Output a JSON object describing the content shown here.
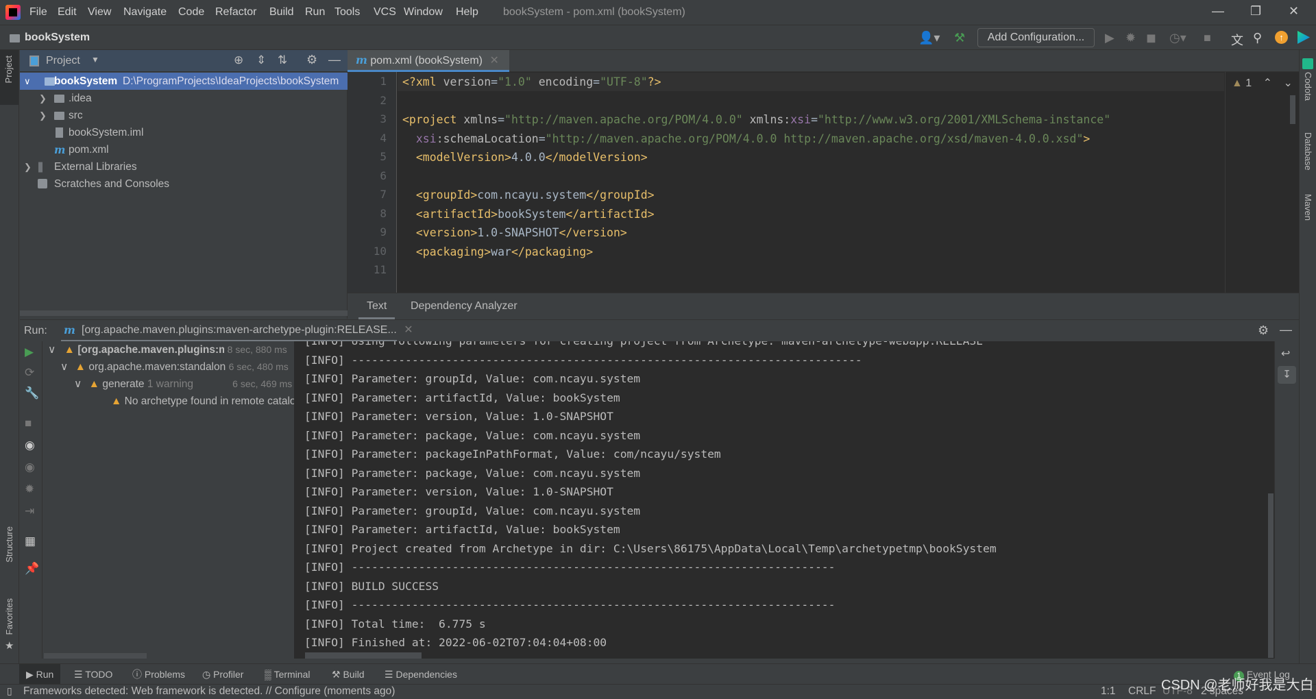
{
  "menubar": {
    "items": [
      "File",
      "Edit",
      "View",
      "Navigate",
      "Code",
      "Refactor",
      "Build",
      "Run",
      "Tools",
      "VCS",
      "Window",
      "Help"
    ],
    "window_title": "bookSystem - pom.xml (bookSystem)"
  },
  "toolbar": {
    "project_name": "bookSystem",
    "add_configuration": "Add Configuration..."
  },
  "left_strip": {
    "project": "Project",
    "structure": "Structure",
    "favorites": "Favorites"
  },
  "right_strip": {
    "codota": "Codota",
    "database": "Database",
    "maven": "Maven"
  },
  "project_panel": {
    "title": "Project",
    "tree": [
      {
        "label": "bookSystem",
        "path": "D:\\ProgramProjects\\IdeaProjects\\bookSystem"
      },
      {
        "label": ".idea"
      },
      {
        "label": "src"
      },
      {
        "label": "bookSystem.iml"
      },
      {
        "label": "pom.xml"
      },
      {
        "label": "External Libraries"
      },
      {
        "label": "Scratches and Consoles"
      }
    ]
  },
  "editor": {
    "tab": "pom.xml (bookSystem)",
    "warnings_count": "1",
    "line_numbers": [
      "1",
      "2",
      "3",
      "4",
      "5",
      "6",
      "7",
      "8",
      "9",
      "10",
      "11"
    ],
    "lines": [
      [
        [
          "<?xml ",
          "tag"
        ],
        [
          "version",
          "attr"
        ],
        [
          "=",
          "txt"
        ],
        [
          "\"1.0\"",
          "str"
        ],
        [
          " encoding",
          "attr"
        ],
        [
          "=",
          "txt"
        ],
        [
          "\"UTF-8\"",
          "str"
        ],
        [
          "?>",
          "tag"
        ]
      ],
      [],
      [
        [
          "<project ",
          "tag"
        ],
        [
          "xmlns",
          "attr"
        ],
        [
          "=",
          "txt"
        ],
        [
          "\"http://maven.apache.org/POM/4.0.0\"",
          "str"
        ],
        [
          " xmlns:",
          "attr"
        ],
        [
          "xsi",
          "ns"
        ],
        [
          "=",
          "txt"
        ],
        [
          "\"http://www.w3.org/2001/XMLSchema-instance\"",
          "str"
        ]
      ],
      [
        [
          "  ",
          "txt"
        ],
        [
          "xsi",
          "ns"
        ],
        [
          ":schemaLocation",
          "attr"
        ],
        [
          "=",
          "txt"
        ],
        [
          "\"http://maven.apache.org/POM/4.0.0 http://maven.apache.org/xsd/maven-4.0.0.xsd\"",
          "str"
        ],
        [
          ">",
          "tag"
        ]
      ],
      [
        [
          "  <modelVersion>",
          "tag"
        ],
        [
          "4.0.0",
          "txt"
        ],
        [
          "</modelVersion>",
          "tag"
        ]
      ],
      [],
      [
        [
          "  <groupId>",
          "tag"
        ],
        [
          "com.ncayu.system",
          "txt"
        ],
        [
          "</groupId>",
          "tag"
        ]
      ],
      [
        [
          "  <artifactId>",
          "tag"
        ],
        [
          "bookSystem",
          "txt"
        ],
        [
          "</artifactId>",
          "tag"
        ]
      ],
      [
        [
          "  <version>",
          "tag"
        ],
        [
          "1.0-SNAPSHOT",
          "txt"
        ],
        [
          "</version>",
          "tag"
        ]
      ],
      [
        [
          "  <packaging>",
          "tag"
        ],
        [
          "war",
          "txt"
        ],
        [
          "</packaging>",
          "tag"
        ]
      ]
    ],
    "bottom_tabs": [
      "Text",
      "Dependency Analyzer"
    ]
  },
  "run": {
    "label": "Run:",
    "tab": "[org.apache.maven.plugins:maven-archetype-plugin:RELEASE...",
    "tree": [
      {
        "label": "[org.apache.maven.plugins:maven-archetype-plugin",
        "time": "8 sec, 880 ms"
      },
      {
        "label": "org.apache.maven:standalone-pom",
        "time": "6 sec, 480 ms"
      },
      {
        "label": "generate",
        "note": "1 warning",
        "time": "6 sec, 469 ms"
      },
      {
        "label": "No archetype found in remote catalog"
      }
    ],
    "console": [
      "[INFO] Using following parameters for creating project from Archetype: maven-archetype-webapp:RELEASE",
      "[INFO] ----------------------------------------------------------------------------",
      "[INFO] Parameter: groupId, Value: com.ncayu.system",
      "[INFO] Parameter: artifactId, Value: bookSystem",
      "[INFO] Parameter: version, Value: 1.0-SNAPSHOT",
      "[INFO] Parameter: package, Value: com.ncayu.system",
      "[INFO] Parameter: packageInPathFormat, Value: com/ncayu/system",
      "[INFO] Parameter: package, Value: com.ncayu.system",
      "[INFO] Parameter: version, Value: 1.0-SNAPSHOT",
      "[INFO] Parameter: groupId, Value: com.ncayu.system",
      "[INFO] Parameter: artifactId, Value: bookSystem",
      "[INFO] Project created from Archetype in dir: C:\\Users\\86175\\AppData\\Local\\Temp\\archetypetmp\\bookSystem",
      "[INFO] ------------------------------------------------------------------------",
      "[INFO] BUILD SUCCESS",
      "[INFO] ------------------------------------------------------------------------",
      "[INFO] Total time:  6.775 s",
      "[INFO] Finished at: 2022-06-02T07:04:04+08:00",
      "[INFO] ------------------------------------------------------------------------"
    ]
  },
  "bottom_tools": [
    "Run",
    "TODO",
    "Problems",
    "Profiler",
    "Terminal",
    "Build",
    "Dependencies"
  ],
  "event_log": {
    "label": "Event Log",
    "count": "1"
  },
  "status": {
    "message": "Frameworks detected: Web framework is detected. // Configure (moments ago)",
    "position": "1:1",
    "line_sep": "CRLF",
    "encoding": "UTF-8",
    "indent": "2 spaces",
    "watermark": "CSDN @老师好我是大白"
  }
}
